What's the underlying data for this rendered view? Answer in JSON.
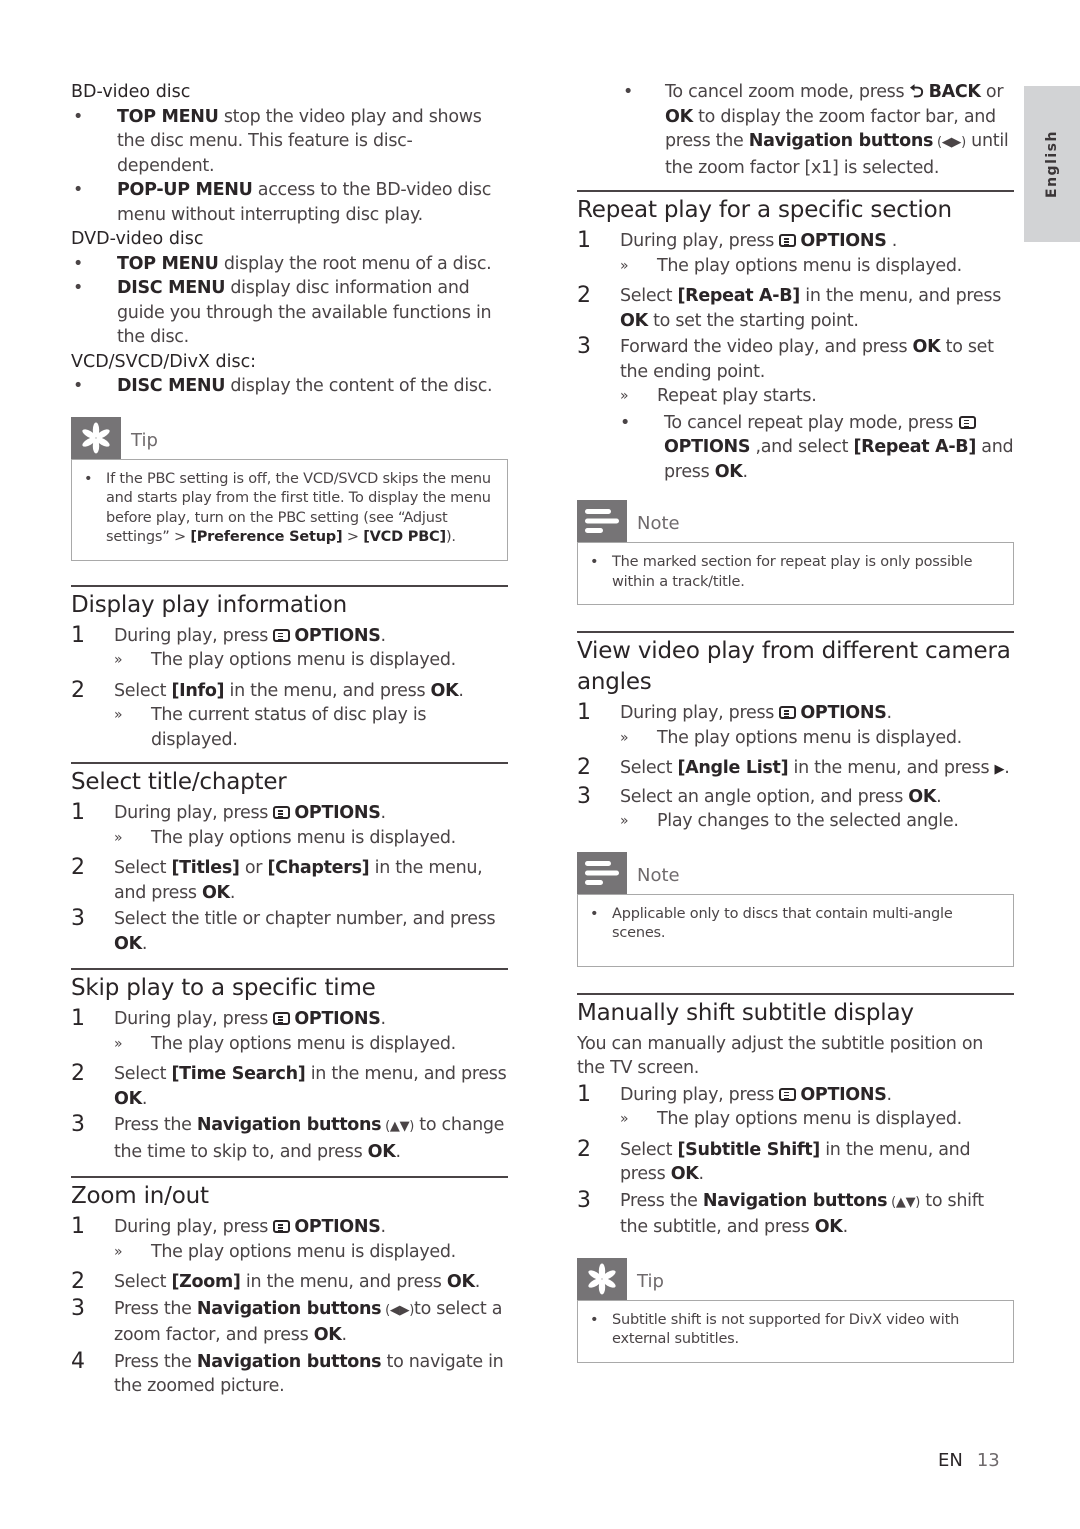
{
  "sidebar": {
    "language_tab": "English"
  },
  "footer": {
    "lang": "EN",
    "page": "13"
  },
  "left": {
    "bd": {
      "heading": "BD-video disc",
      "items": [
        {
          "key": "TOP MENU",
          "text": " stop the video play and shows the disc menu. This feature is disc-dependent."
        },
        {
          "key": "POP-UP MENU",
          "text": " access to the BD-video disc menu without interrupting disc play."
        }
      ]
    },
    "dvd": {
      "heading": "DVD-video disc",
      "items": [
        {
          "key": "TOP MENU",
          "text": " display the root menu of a disc."
        },
        {
          "key": "DISC MENU",
          "text": " display disc information and guide you through the available functions in the disc."
        }
      ]
    },
    "vcd": {
      "heading": "VCD/SVCD/DivX disc:",
      "items": [
        {
          "key": "DISC MENU",
          "text": " display the content of the disc."
        }
      ]
    },
    "tip1": {
      "title": "Tip",
      "text_a": "If the PBC setting is off, the VCD/SVCD skips the menu and starts play from the first title. To display the menu before play, turn on the PBC setting (see “Adjust settings” > ",
      "b1": "[Preference Setup]",
      "sep": " > ",
      "b2": "[VCD PBC]",
      "text_b": ")."
    },
    "display_info": {
      "title": "Display play information",
      "s1_pre": "During play, press ",
      "s1_key": "OPTIONS",
      "s1_post": ".",
      "s1_result": "The play options menu is displayed.",
      "s2_pre": "Select ",
      "s2_key": "[Info]",
      "s2_mid": " in the menu, and press ",
      "s2_ok": "OK",
      "s2_post": ".",
      "s2_result": "The current status of disc play is displayed."
    },
    "title_chapter": {
      "title": "Select title/chapter",
      "s1_pre": "During play, press ",
      "s1_key": "OPTIONS",
      "s1_post": ".",
      "s1_result": "The play options menu is displayed.",
      "s2_pre": "Select ",
      "s2_key1": "[Titles]",
      "s2_or": " or ",
      "s2_key2": "[Chapters]",
      "s2_mid": " in the menu, and press ",
      "s2_ok": "OK",
      "s2_post": ".",
      "s3_pre": "Select the title or chapter number, and press ",
      "s3_ok": "OK",
      "s3_post": "."
    },
    "skip_time": {
      "title": "Skip play to a specific time",
      "s1_pre": "During play, press ",
      "s1_key": "OPTIONS",
      "s1_post": ".",
      "s1_result": "The play options menu is displayed.",
      "s2_pre": "Select ",
      "s2_key": "[Time Search]",
      "s2_mid": " in the menu, and press ",
      "s2_ok": "OK",
      "s2_post": ".",
      "s3_pre": "Press the ",
      "s3_key": "Navigation buttons",
      "s3_arrows": " (▲▼)",
      "s3_mid": " to change the time to skip to, and press ",
      "s3_ok": "OK",
      "s3_post": "."
    },
    "zoom": {
      "title": "Zoom in/out",
      "s1_pre": "During play, press ",
      "s1_key": "OPTIONS",
      "s1_post": ".",
      "s1_result": "The play options menu is displayed.",
      "s2_pre": "Select ",
      "s2_key": "[Zoom]",
      "s2_mid": " in the menu, and press ",
      "s2_ok": "OK",
      "s2_post": ".",
      "s3_pre": "Press the ",
      "s3_key": "Navigation buttons",
      "s3_arrows": " (◀▶)",
      "s3_mid": "to select a zoom factor, and press ",
      "s3_ok": "OK",
      "s3_post": ".",
      "s4_pre": "Press the ",
      "s4_key": "Navigation buttons",
      "s4_post": " to navigate in the zoomed picture."
    }
  },
  "right": {
    "zoom_cancel": {
      "pre": "To cancel zoom mode, press ",
      "back_key": "BACK",
      "or": " or ",
      "ok": "OK",
      "mid": " to display the zoom factor bar, and press the ",
      "nav": "Navigation buttons",
      "arrows": " (◀▶)",
      "post": " until the zoom factor [x1] is selected."
    },
    "repeat": {
      "title": "Repeat play for a specific section",
      "s1_pre": "During play, press ",
      "s1_key": "OPTIONS",
      "s1_post": " .",
      "s1_result": "The play options menu is displayed.",
      "s2_pre": "Select ",
      "s2_key": "[Repeat A-B]",
      "s2_mid": " in the menu, and press ",
      "s2_ok": "OK",
      "s2_post": " to set the starting point.",
      "s3_pre": "Forward the video play, and press ",
      "s3_ok": "OK",
      "s3_post": " to set the ending point.",
      "s3_result": "Repeat play starts.",
      "cancel_pre": "To cancel repeat play mode, press ",
      "cancel_key": "OPTIONS",
      "cancel_mid": " ,and select ",
      "cancel_key2": "[Repeat A-B]",
      "cancel_and": " and press ",
      "cancel_ok": "OK",
      "cancel_post": "."
    },
    "note1": {
      "title": "Note",
      "text": "The marked section for repeat play is only possible within a track/title."
    },
    "angles": {
      "title": "View video play from different camera angles",
      "s1_pre": "During play, press ",
      "s1_key": "OPTIONS",
      "s1_post": ".",
      "s1_result": "The play options menu is displayed.",
      "s2_pre": "Select ",
      "s2_key": "[Angle List]",
      "s2_mid": " in the menu, and press ",
      "s2_arrow": "▶",
      "s2_post": ".",
      "s3_pre": "Select an angle option, and press ",
      "s3_ok": "OK",
      "s3_post": ".",
      "s3_result": "Play changes to the selected angle."
    },
    "note2": {
      "title": "Note",
      "text": "Applicable only to discs that contain multi-angle scenes."
    },
    "subtitle": {
      "title": "Manually shift subtitle display",
      "intro": "You can manually adjust the subtitle position on the TV screen.",
      "s1_pre": "During play, press ",
      "s1_key": "OPTIONS",
      "s1_post": ".",
      "s1_result": "The play options menu is displayed.",
      "s2_pre": " Select ",
      "s2_key": "[Subtitle Shift]",
      "s2_mid": " in the menu, and press ",
      "s2_ok": "OK",
      "s2_post": ".",
      "s3_pre": "Press the ",
      "s3_key": "Navigation buttons",
      "s3_arrows": " (▲▼)",
      "s3_mid": " to shift the subtitle, and press ",
      "s3_ok": "OK",
      "s3_post": "."
    },
    "tip2": {
      "title": "Tip",
      "text": "Subtitle shift is not supported for DivX video with external subtitles."
    }
  }
}
